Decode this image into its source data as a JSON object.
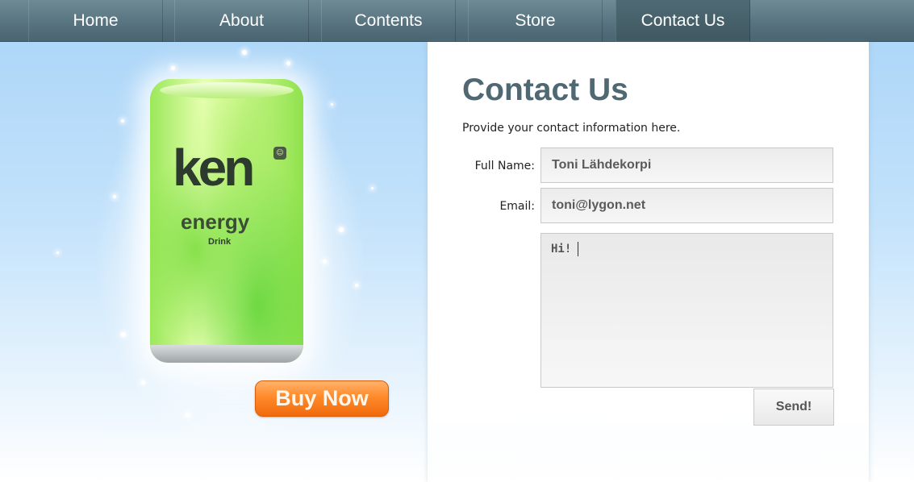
{
  "nav": {
    "items": [
      {
        "label": "Home",
        "active": false
      },
      {
        "label": "About",
        "active": false
      },
      {
        "label": "Contents",
        "active": false
      },
      {
        "label": "Store",
        "active": false
      },
      {
        "label": "Contact Us",
        "active": true
      }
    ]
  },
  "promo": {
    "product_logo": "ken",
    "product_name": "energy",
    "product_sub": "Drink",
    "buy_label": "Buy Now"
  },
  "contact": {
    "title": "Contact Us",
    "intro": "Provide your contact information here.",
    "full_name_label": "Full Name:",
    "full_name_value": "Toni Lähdekorpi",
    "email_label": "Email:",
    "email_value": "toni@lygon.net",
    "message_value": "Hi!",
    "send_label": "Send!"
  },
  "colors": {
    "nav_bg": "#587480",
    "accent_orange": "#ff8a2a",
    "title_color": "#4f6872"
  }
}
